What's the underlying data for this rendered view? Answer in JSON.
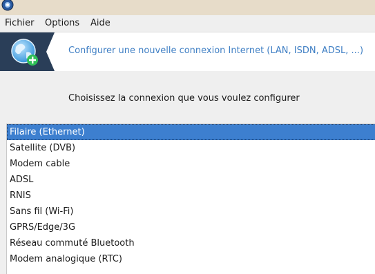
{
  "menu": [
    {
      "id": "fichier",
      "label": "Fichier"
    },
    {
      "id": "options",
      "label": "Options"
    },
    {
      "id": "aide",
      "label": "Aide"
    }
  ],
  "header": {
    "title": "Configurer une nouvelle connexion Internet (LAN, ISDN, ADSL, ...)",
    "icon": "network-globe-add-icon"
  },
  "prompt": "Choisissez la connexion que vous voulez configurer",
  "connections": [
    {
      "label": "Filaire (Ethernet)",
      "selected": true
    },
    {
      "label": "Satellite (DVB)",
      "selected": false
    },
    {
      "label": "Modem cable",
      "selected": false
    },
    {
      "label": "ADSL",
      "selected": false
    },
    {
      "label": "RNIS",
      "selected": false
    },
    {
      "label": "Sans fil (Wi-Fi)",
      "selected": false
    },
    {
      "label": "GPRS/Edge/3G",
      "selected": false
    },
    {
      "label": "Réseau commuté Bluetooth",
      "selected": false
    },
    {
      "label": "Modem analogique (RTC)",
      "selected": false
    }
  ],
  "colors": {
    "accent": "#3d7fcf",
    "header_title": "#3f7fc4",
    "header_icon_bg": "#2a3e58",
    "titlebar": "#e7dcc9"
  }
}
